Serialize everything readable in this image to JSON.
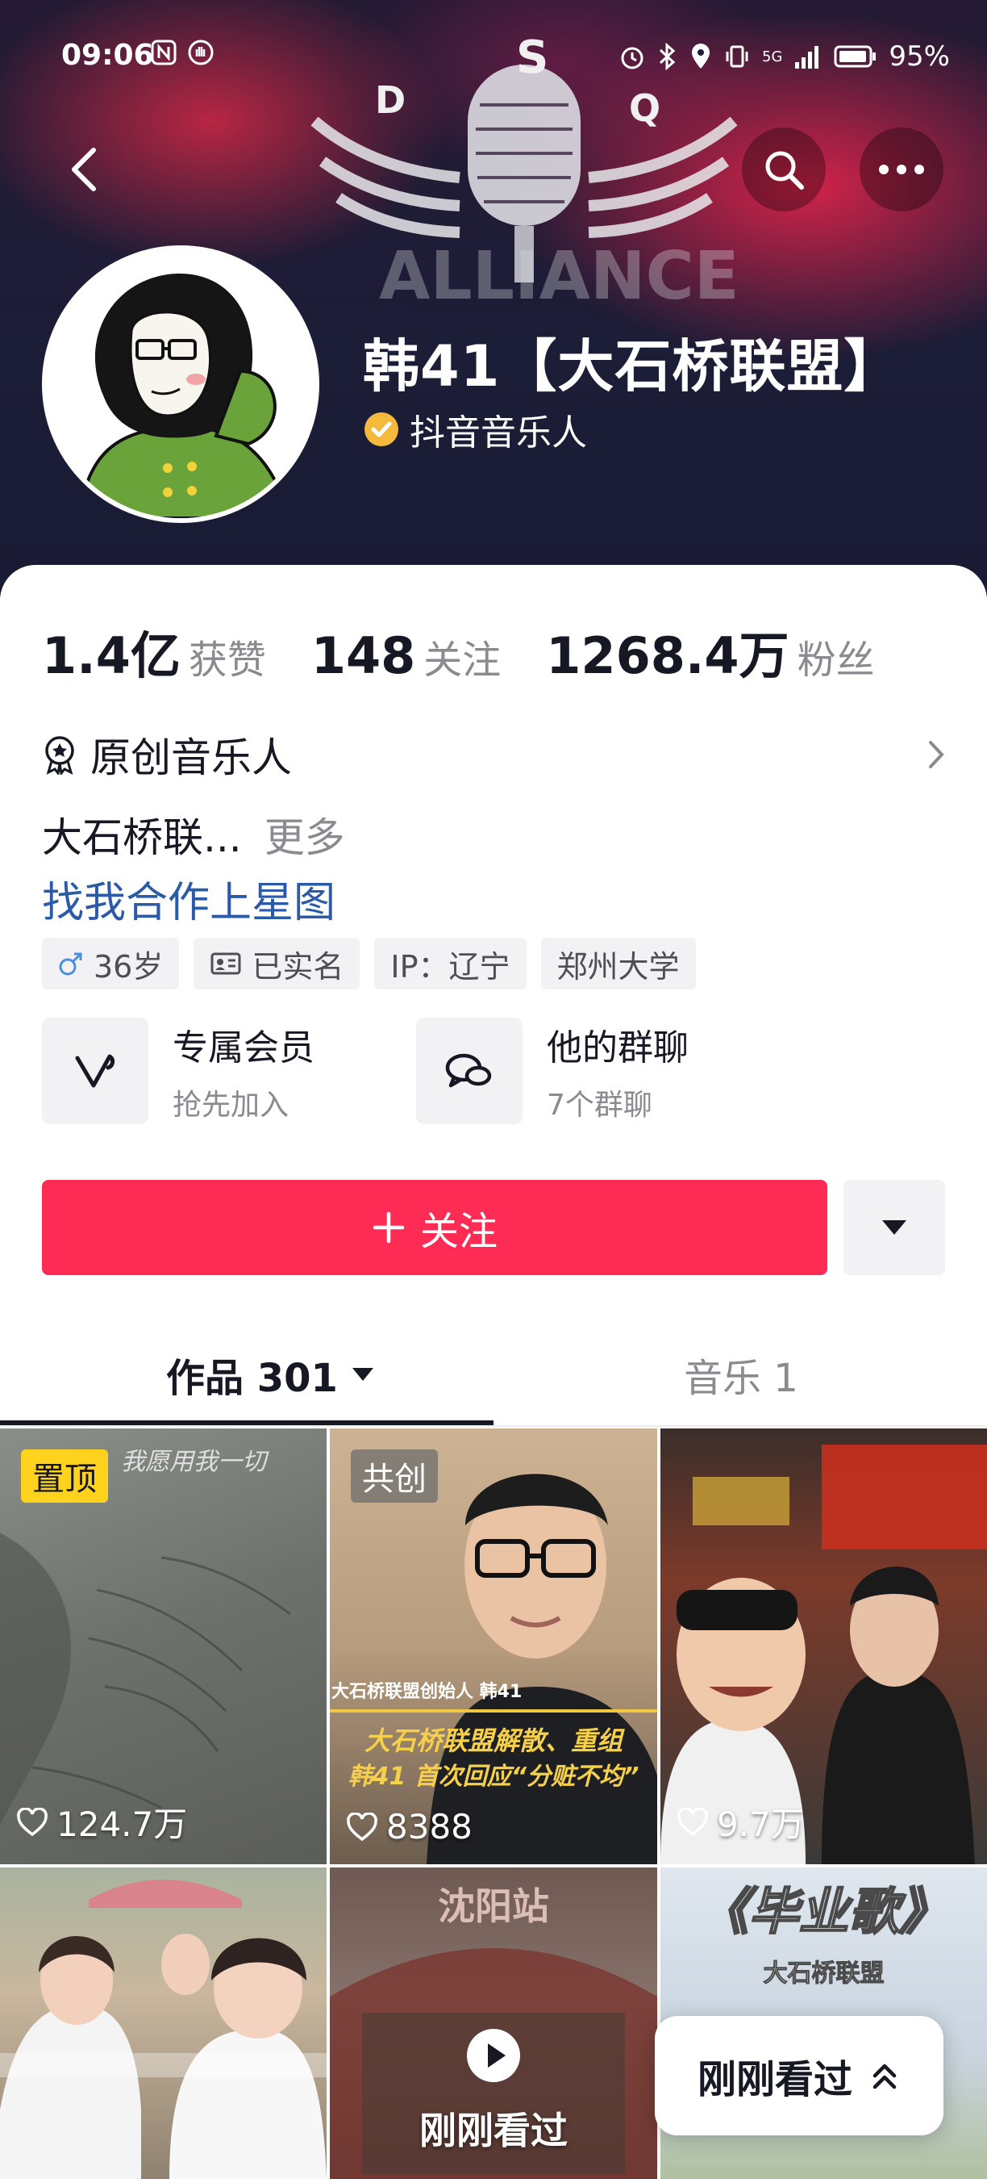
{
  "status_bar": {
    "time": "09:06",
    "network": "5G",
    "battery": "95%"
  },
  "header": {
    "profile_name": "韩41【大石桥联盟】",
    "badge_label": "抖音音乐人",
    "banner_brand_text": "ALLIANCE"
  },
  "stats": [
    {
      "value": "1.4亿",
      "label": "获赞"
    },
    {
      "value": "148",
      "label": "关注"
    },
    {
      "value": "1268.4万",
      "label": "粉丝"
    }
  ],
  "verification": {
    "label": "原创音乐人"
  },
  "bio": {
    "text": "大石桥联...",
    "more": "更多"
  },
  "collab_link": "找我合作上星图",
  "tags": {
    "age": "36岁",
    "realname": "已实名",
    "ip": "IP：辽宁",
    "school": "郑州大学"
  },
  "features": {
    "member": {
      "title": "专属会员",
      "subtitle": "抢先加入"
    },
    "group": {
      "title": "他的群聊",
      "subtitle": "7个群聊"
    }
  },
  "actions": {
    "follow": "关注"
  },
  "tabs": {
    "works": "作品 301",
    "music": "音乐 1"
  },
  "videos": [
    {
      "tag": "置顶",
      "likes": "124.7万",
      "overlay": "我愿用我一切"
    },
    {
      "tag": "共创",
      "likes": "8388",
      "caption_top": "大石桥联盟创始人 韩41",
      "caption_line1": "大石桥联盟解散、重组",
      "caption_line2": "韩41 首次回应“分赃不均”"
    },
    {
      "likes": "9.7万"
    },
    {},
    {
      "overlay": "刚刚看过",
      "sign": "沈阳站"
    },
    {
      "title": "《毕业歌》",
      "subtitle": "大石桥联盟"
    }
  ],
  "recent_pill": "刚刚看过",
  "colors": {
    "accent": "#fe2c55",
    "link": "#2b5aa8",
    "badge": "#f5b93b",
    "pin_chip": "#ffd21e"
  }
}
